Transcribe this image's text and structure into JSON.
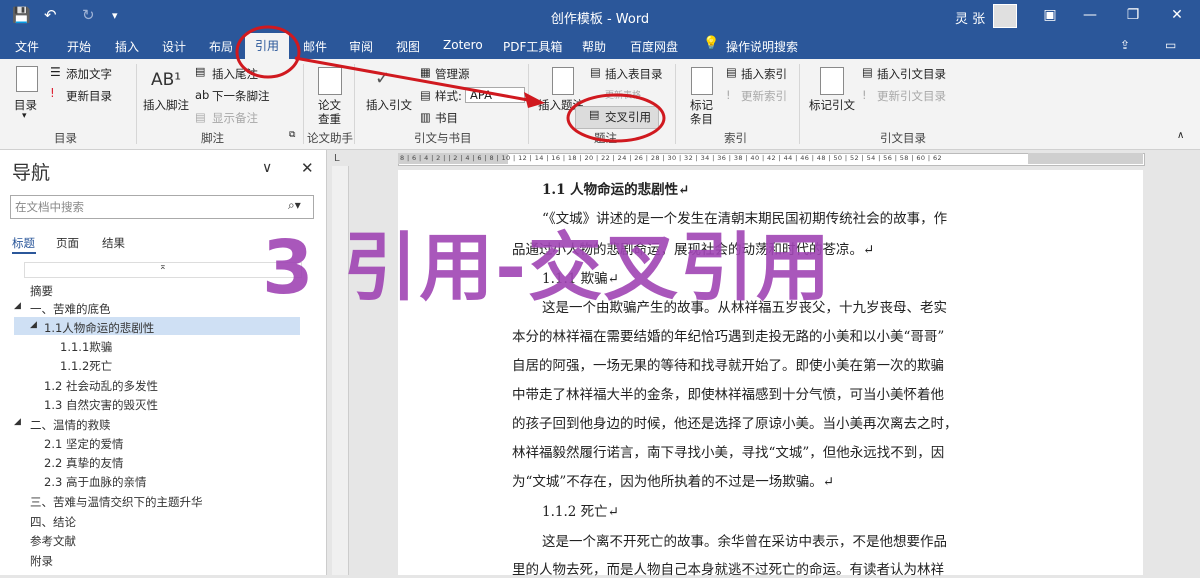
{
  "titlebar": {
    "save_icon": "save-icon",
    "undo_icon": "undo-icon",
    "redo_icon": "redo-icon",
    "title": "创作模板  -  Word",
    "user": "灵 张",
    "min": "—",
    "restore": "❐",
    "close": "✕"
  },
  "tabs": [
    "文件",
    "开始",
    "插入",
    "设计",
    "布局",
    "引用",
    "邮件",
    "审阅",
    "视图",
    "Zotero",
    "PDF工具箱",
    "帮助",
    "百度网盘"
  ],
  "active_tab": "引用",
  "tell_me": "操作说明搜索",
  "ribbon": {
    "toc": {
      "label": "目录",
      "add_text": "添加文字",
      "update": "更新目录",
      "group": "目录"
    },
    "footnote": {
      "insert": "插入脚注",
      "insert_endnote": "插入尾注",
      "next": "下一条脚注",
      "show": "显示备注",
      "group": "脚注",
      "ab": "AB¹"
    },
    "research": {
      "label1": "论文",
      "label2": "查重",
      "group": "论文助手"
    },
    "citation": {
      "insert": "插入引文",
      "manage": "管理源",
      "style_label": "样式:",
      "style_value": "APA",
      "bib": "书目",
      "group": "引文与书目"
    },
    "caption": {
      "insert": "插入题注",
      "insert_table": "插入表目录",
      "update_table": "更新表格",
      "cross_ref": "交叉引用",
      "group": "题注"
    },
    "index": {
      "mark": "标记",
      "mark2": "条目",
      "insert": "插入索引",
      "update": "更新索引",
      "group": "索引"
    },
    "toa": {
      "mark": "标记引文",
      "insert": "插入引文目录",
      "update": "更新引文目录",
      "group": "引文目录"
    }
  },
  "nav": {
    "title": "导航",
    "search_placeholder": "在文档中搜索",
    "tabs": [
      "标题",
      "页面",
      "结果"
    ],
    "items": [
      {
        "text": "摘要"
      },
      {
        "text": "一、苦难的底色"
      },
      {
        "text": "1.1人物命运的悲剧性"
      },
      {
        "text": "1.1.1欺骗"
      },
      {
        "text": "1.1.2死亡"
      },
      {
        "text": "1.2 社会动乱的多发性"
      },
      {
        "text": "1.3 自然灾害的毁灭性"
      },
      {
        "text": "二、温情的救赎"
      },
      {
        "text": "2.1 坚定的爱情"
      },
      {
        "text": "2.2 真挚的友情"
      },
      {
        "text": "2.3 高于血脉的亲情"
      },
      {
        "text": "三、苦难与温情交织下的主题升华"
      },
      {
        "text": "四、结论"
      },
      {
        "text": "参考文献"
      },
      {
        "text": "附录"
      }
    ]
  },
  "ruler": "8 | 6 | 4 | 2 | | 2 | 4 | 6 | 8 | 10 | 12 | 14 | 16 | 18 | 20 | 22 | 24 | 26 | 28 | 30 | 32 | 34 | 36 | 38 | 40 | 42 | 44 | 46 | 48 | 50 | 52 | 54 | 56 | 58 | 60 | 62",
  "doc": {
    "h1": "1.1 人物命运的悲剧性↵",
    "p1": [
      "“《文城》讲述的是一个发生在清朝末期民国初期传统社会的故事，作",
      "品通过小人物的悲剧命运，展现社会的动荡和时代的苍凉。↵",
      "1.1.1 欺骗↵"
    ],
    "p2": [
      "这是一个由欺骗产生的故事。从林祥福五岁丧父，十九岁丧母、老实",
      "本分的林祥福在需要结婚的年纪恰巧遇到走投无路的小美和以小美“哥哥”",
      "自居的阿强，一场无果的等待和找寻就开始了。即使小美在第一次的欺骗",
      "中带走了林祥福大半的金条，即使林祥福感到十分气愤，可当小美怀着他",
      "的孩子回到他身边的时候，他还是选择了原谅小美。当小美再次离去之时，",
      "林祥福毅然履行诺言，南下寻找小美，寻找“文城”，但他永远找不到，因",
      "为“文城”不存在，因为他所执着的不过是一场欺骗。↵"
    ],
    "h2": "1.1.2 死亡↵",
    "p3": [
      "这是一个离不开死亡的故事。余华曾在采访中表示，不是他想要作品",
      "里的人物去死，而是人物自己本身就逃不过死亡的命运。有读者认为林祥"
    ]
  },
  "overlay_text": "3 引用-交叉引用",
  "colors": {
    "word_blue": "#2b579a",
    "annotation_red": "#d0191f",
    "overlay_purple": "#a045b4"
  }
}
